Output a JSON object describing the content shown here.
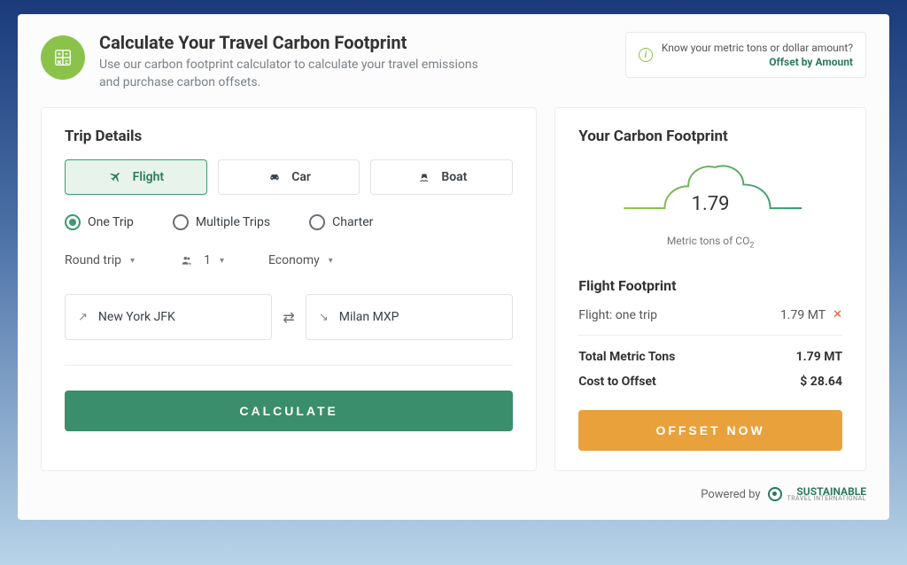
{
  "header": {
    "title": "Calculate Your Travel Carbon Footprint",
    "subtitle": "Use our carbon footprint calculator to calculate your travel emissions and purchase carbon offsets."
  },
  "offset_by_amount": {
    "prompt": "Know your metric tons or dollar amount?",
    "link": "Offset by Amount"
  },
  "trip_details": {
    "heading": "Trip Details",
    "tabs": {
      "flight": "Flight",
      "car": "Car",
      "boat": "Boat"
    },
    "radios": {
      "one_trip": "One Trip",
      "multiple_trips": "Multiple Trips",
      "charter": "Charter"
    },
    "drops": {
      "trip_kind": "Round trip",
      "passengers": "1",
      "class": "Economy"
    },
    "from": "New York JFK",
    "to": "Milan MXP",
    "calculate_label": "CALCULATE"
  },
  "footprint": {
    "heading": "Your Carbon Footprint",
    "value": "1.79",
    "unit_html": "Metric tons of CO",
    "section_title": "Flight Footprint",
    "line_label": "Flight: one trip",
    "line_value": "1.79 MT",
    "total_label": "Total Metric Tons",
    "total_value": "1.79 MT",
    "cost_label": "Cost to Offset",
    "cost_value": "$ 28.64",
    "offset_label": "OFFSET NOW"
  },
  "powered": {
    "prefix": "Powered by",
    "brand1": "SUSTAINABLE",
    "brand2": "TRAVEL INTERNATIONAL"
  }
}
